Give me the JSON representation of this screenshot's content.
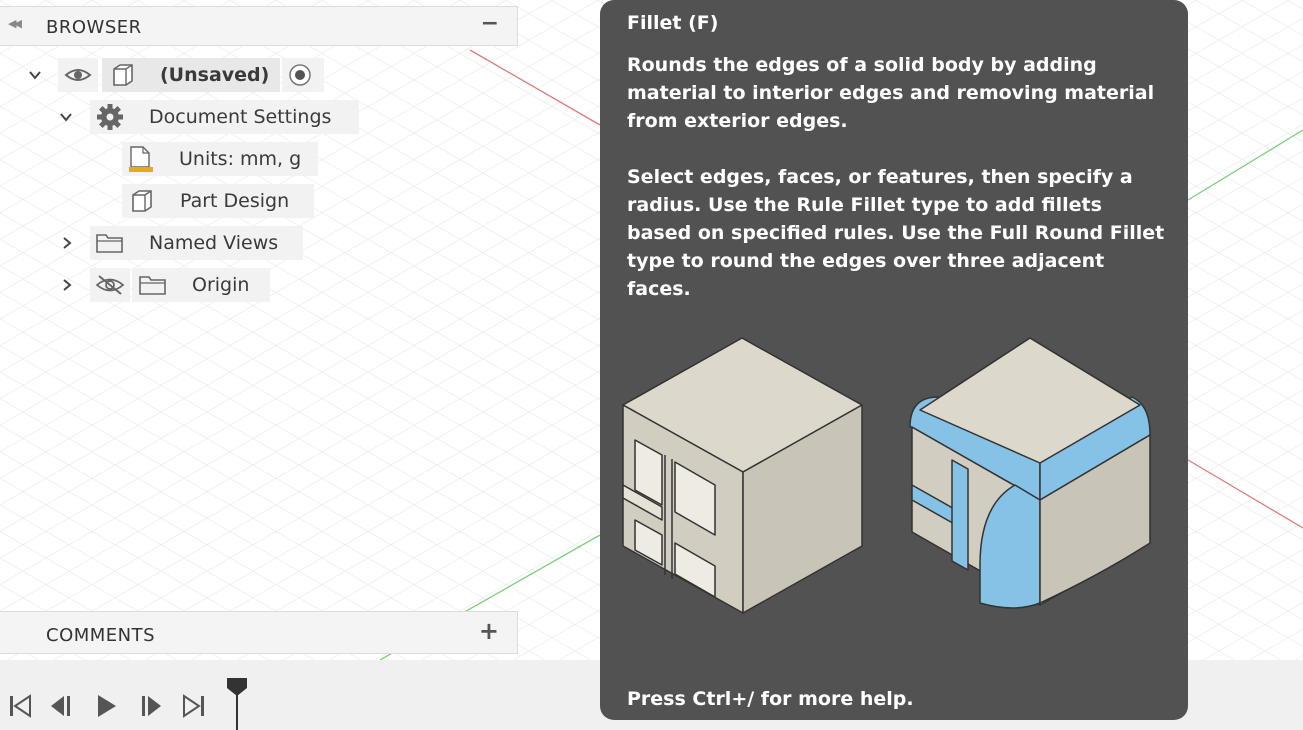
{
  "browser": {
    "title": "BROWSER",
    "root": {
      "label": "(Unsaved)"
    },
    "items": [
      {
        "label": "Document Settings"
      },
      {
        "label": "Units: mm, g"
      },
      {
        "label": "Part Design"
      },
      {
        "label": "Named Views"
      },
      {
        "label": "Origin"
      }
    ]
  },
  "comments": {
    "title": "COMMENTS"
  },
  "tooltip": {
    "title": "Fillet (F)",
    "paragraph1": "Rounds the edges of a solid body by adding material to interior edges and removing material from exterior edges.",
    "paragraph2": "Select edges, faces, or features, then specify a radius. Use the Rule Fillet type to add fillets based on specified rules. Use the Full Round Fillet type to round the edges over three adjacent faces.",
    "footer": "Press Ctrl+/ for more help."
  },
  "icons": {
    "collapse": "double-chevron-left-icon",
    "eye": "eye-icon",
    "body": "box-icon",
    "radio": "radio-target-icon",
    "gear": "gear-icon",
    "units": "document-ruler-icon",
    "folder": "folder-icon",
    "hidden": "eye-off-icon"
  },
  "colors": {
    "tooltip_bg": "#525252",
    "panel_bg": "#f4f4f4",
    "chip_bg": "#f2f2f2",
    "fillet_blue": "#86c1e6",
    "cube_face": "#ddd8cc",
    "x_axis": "#e07a7a",
    "y_axis": "#7ad07a"
  }
}
